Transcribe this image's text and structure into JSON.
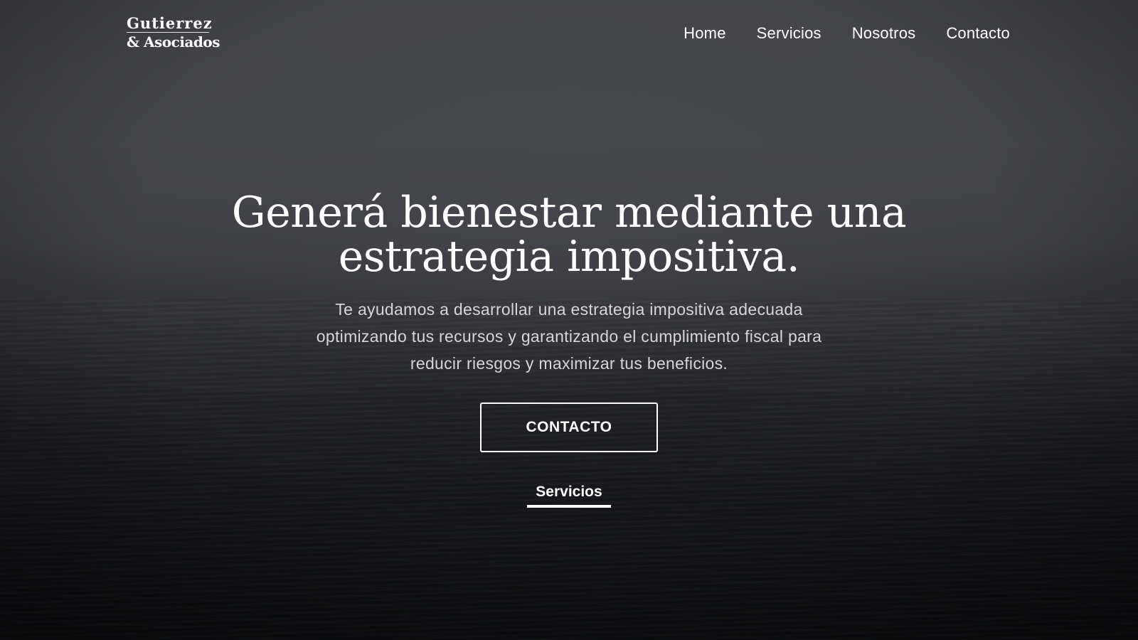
{
  "brand": {
    "line1": "Gutierrez",
    "line2": "& Asociados"
  },
  "nav": {
    "items": [
      {
        "label": "Home"
      },
      {
        "label": "Servicios"
      },
      {
        "label": "Nosotros"
      },
      {
        "label": "Contacto"
      }
    ]
  },
  "hero": {
    "headline_line1": "Generá bienestar mediante una",
    "headline_line2": "estrategia impositiva.",
    "subtitle_line1": "Te ayudamos a desarrollar una estrategia impositiva adecuada",
    "subtitle_line2": "optimizando tus recursos y garantizando el cumplimiento fiscal para",
    "subtitle_line3": "reducir riesgos y maximizar tus beneficios.",
    "cta_label": "CONTACTO",
    "services_link_label": "Servicios"
  },
  "colors": {
    "text": "#ffffff",
    "subtitle": "#d6d6d8",
    "background_top": "#45464c",
    "background_bottom": "#0e0f11"
  }
}
